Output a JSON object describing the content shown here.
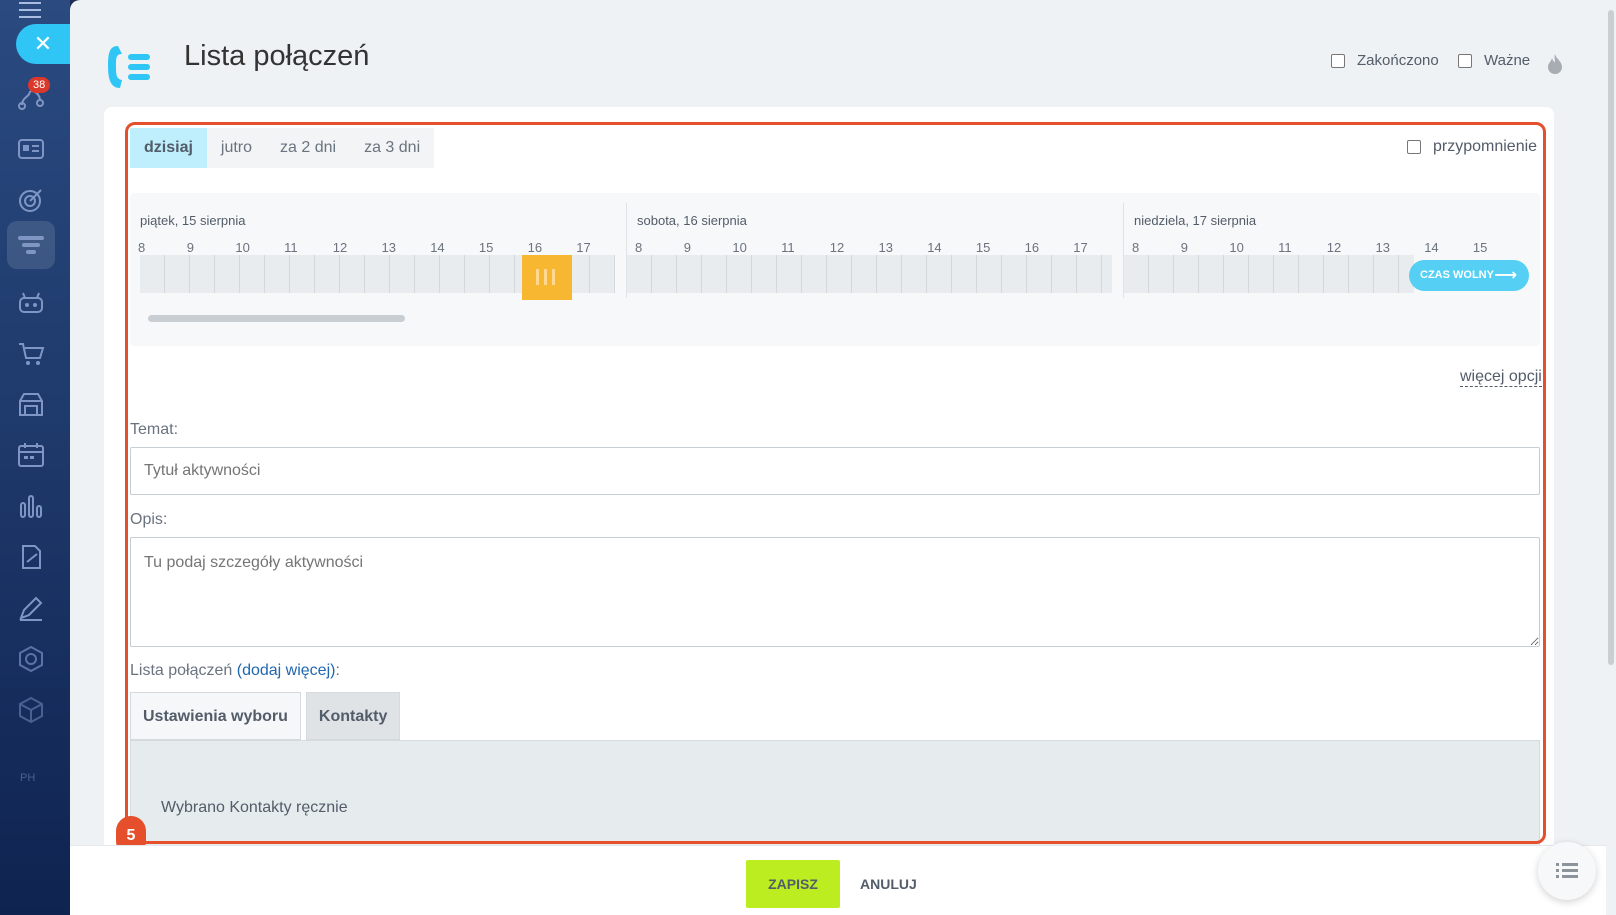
{
  "sidebar": {
    "badge_count": "38",
    "bottom_text": "PH",
    "icons": [
      "activity-stream-icon",
      "crm-card-icon",
      "target-icon",
      "filter-icon",
      "robot-icon",
      "cart-icon",
      "store-icon",
      "calendar-icon",
      "chart-icon",
      "document-sign-icon",
      "pen-icon",
      "settings-hex-icon",
      "box-icon"
    ]
  },
  "header": {
    "title": "Lista połączeń",
    "completed_label": "Zakończono",
    "important_label": "Ważne"
  },
  "day_tabs": [
    "dzisiaj",
    "jutro",
    "za 2 dni",
    "za 3 dni"
  ],
  "active_tab": "dzisiaj",
  "reminder_label": "przypomnienie",
  "timeline": {
    "days": [
      {
        "label": "piątek, 15 sierpnia",
        "hours": [
          "8",
          "9",
          "10",
          "11",
          "12",
          "13",
          "14",
          "15",
          "16",
          "17"
        ]
      },
      {
        "label": "sobota, 16 sierpnia",
        "hours": [
          "8",
          "9",
          "10",
          "11",
          "12",
          "13",
          "14",
          "15",
          "16",
          "17"
        ]
      },
      {
        "label": "niedziela, 17 sierpnia",
        "hours": [
          "8",
          "9",
          "10",
          "11",
          "12",
          "13",
          "14",
          "15"
        ]
      }
    ],
    "free_time_button": "CZAS WOLNY"
  },
  "more_options": "więcej opcji",
  "subject": {
    "label": "Temat:",
    "placeholder": "Tytuł aktywności"
  },
  "description": {
    "label": "Opis:",
    "placeholder": "Tu podaj szczegóły aktywności"
  },
  "call_list": {
    "label": "Lista połączeń",
    "add_more": "(dodaj więcej)",
    "colon": ":"
  },
  "sub_tabs": [
    "Ustawienia wyboru",
    "Kontakty"
  ],
  "selection_text": "Wybrano Kontakty ręcznie",
  "step_number": "5",
  "footer": {
    "save": "ZAPISZ",
    "cancel": "ANULUJ"
  },
  "colors": {
    "accent": "#2fc6f6",
    "highlight": "#e54f2b",
    "save": "#bbed21",
    "slot": "#f8b731"
  }
}
